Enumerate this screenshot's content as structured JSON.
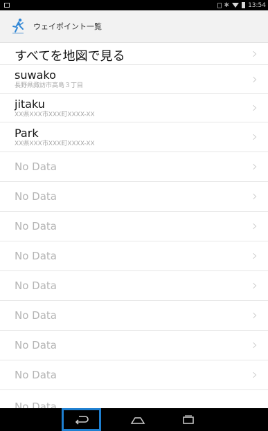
{
  "status_bar": {
    "time": "13:54",
    "icons": [
      "notification-icon",
      "sim-icon",
      "bluetooth-icon",
      "wifi-icon",
      "battery-icon"
    ]
  },
  "app_bar": {
    "icon": "runner-icon",
    "title": "ウェイポイント一覧"
  },
  "list": {
    "show_all": "すべてを地図で見る",
    "waypoints": [
      {
        "name": "suwako",
        "address": "長野県諏訪市高島３丁目"
      },
      {
        "name": "jitaku",
        "address": "XX県XXX市XXX町XXXX-XX"
      },
      {
        "name": "Park",
        "address": "XX県XXX市XXX町XXXX-XX"
      }
    ],
    "empty_label": "No Data"
  },
  "nav_bar": {
    "buttons": [
      "back-icon",
      "home-icon",
      "recent-apps-icon"
    ]
  },
  "colors": {
    "highlight": "#1e7fd0",
    "app_bar_bg": "#f2f2f2",
    "runner_blue": "#2f86d6"
  }
}
